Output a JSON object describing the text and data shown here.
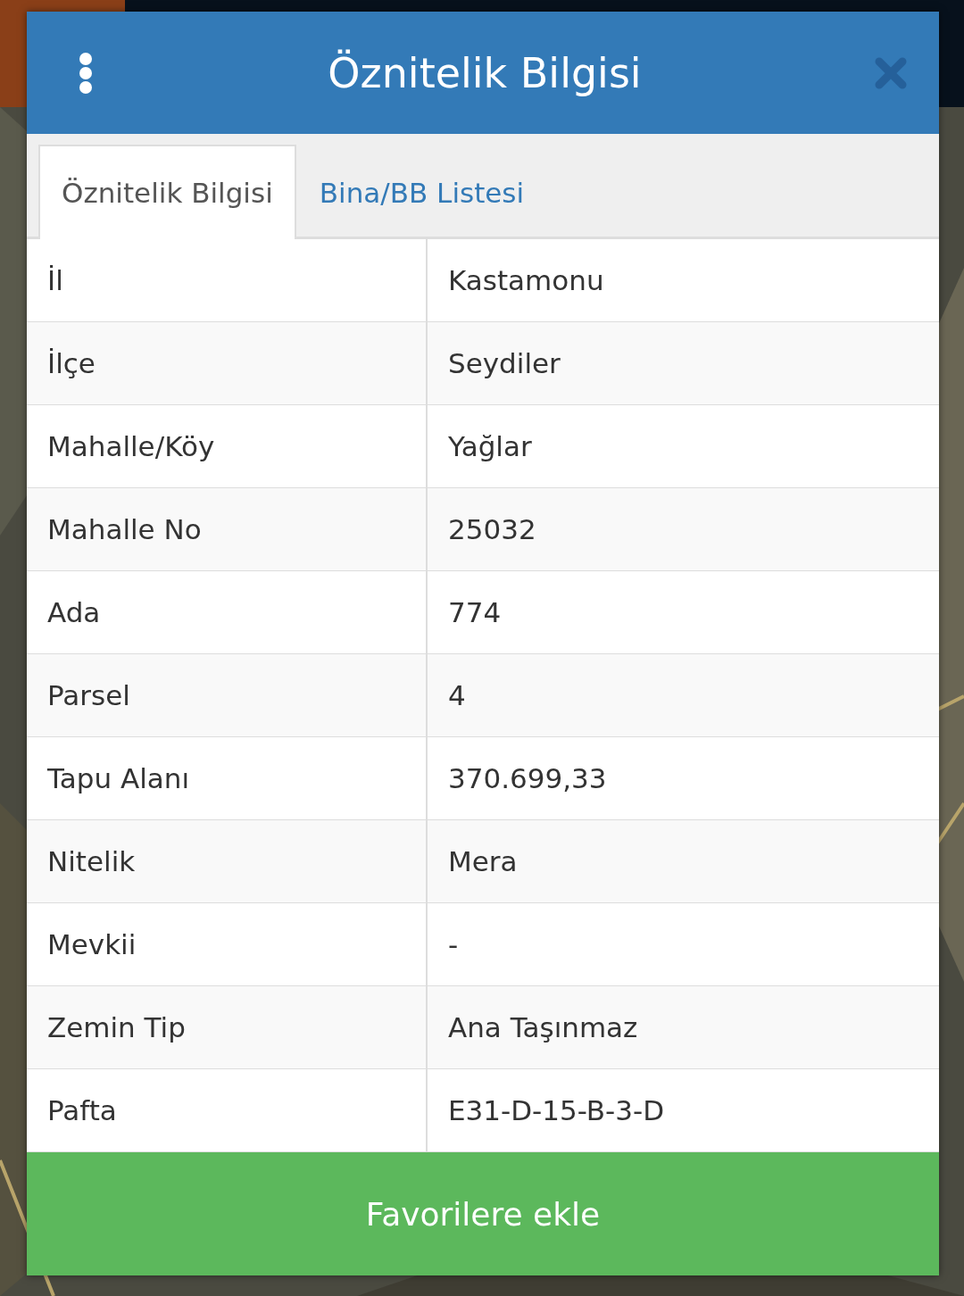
{
  "dialog": {
    "title": "Öznitelik Bilgisi"
  },
  "tabs": [
    {
      "label": "Öznitelik Bilgisi",
      "selected": true
    },
    {
      "label": "Bina/BB Listesi",
      "selected": false
    }
  ],
  "rows": [
    {
      "label": "İl",
      "value": "Kastamonu"
    },
    {
      "label": "İlçe",
      "value": "Seydiler"
    },
    {
      "label": "Mahalle/Köy",
      "value": "Yağlar"
    },
    {
      "label": "Mahalle No",
      "value": "25032"
    },
    {
      "label": "Ada",
      "value": "774"
    },
    {
      "label": "Parsel",
      "value": "4"
    },
    {
      "label": "Tapu Alanı",
      "value": "370.699,33"
    },
    {
      "label": "Nitelik",
      "value": "Mera"
    },
    {
      "label": "Mevkii",
      "value": "-"
    },
    {
      "label": "Zemin Tip",
      "value": "Ana Taşınmaz"
    },
    {
      "label": "Pafta",
      "value": "E31-D-15-B-3-D"
    }
  ],
  "button": {
    "label": "Favorilere ekle"
  }
}
